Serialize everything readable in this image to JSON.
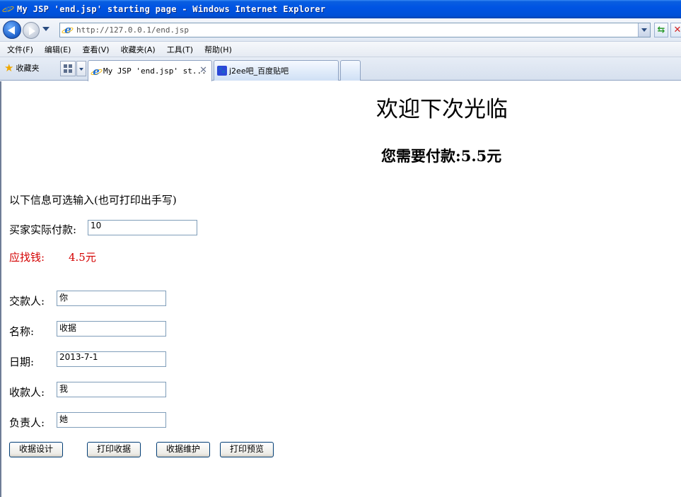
{
  "window": {
    "title": "My JSP 'end.jsp' starting page - Windows Internet Explorer"
  },
  "address_bar": {
    "url": "http://127.0.0.1/end.jsp"
  },
  "menu": {
    "items": [
      "文件(F)",
      "编辑(E)",
      "查看(V)",
      "收藏夹(A)",
      "工具(T)",
      "帮助(H)"
    ]
  },
  "favorites": {
    "label": "收藏夹"
  },
  "tabs": [
    {
      "label": "My JSP 'end.jsp' st..."
    },
    {
      "label": "j2ee吧_百度贴吧"
    }
  ],
  "page": {
    "heading": "欢迎下次光临",
    "amount_due": "您需要付款:5.5元",
    "optional_note": "以下信息可选输入(也可打印出手写)",
    "actual_payment_label": "买家实际付款:",
    "actual_payment_value": "10",
    "change_label": "应找钱:",
    "change_value": "4.5元",
    "payer_label": "交款人:",
    "payer_value": "你",
    "name_label": "名称:",
    "name_value": "收据",
    "date_label": "日期:",
    "date_value": "2013-7-1",
    "payee_label": "收款人:",
    "payee_value": "我",
    "responsible_label": "负责人:",
    "responsible_value": "她",
    "buttons": {
      "design": "收据设计",
      "print": "打印收据",
      "maintain": "收据维护",
      "preview": "打印预览"
    }
  }
}
